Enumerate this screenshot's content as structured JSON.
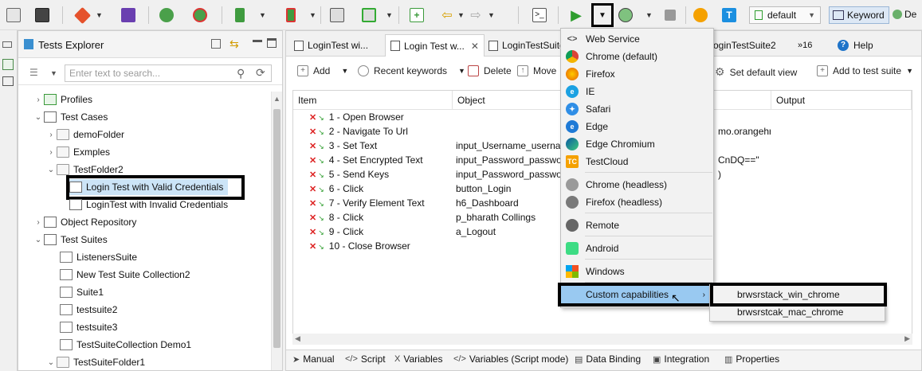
{
  "toolbar": {
    "profile_value": "default",
    "keyword_label": "Keyword",
    "de_label": "De"
  },
  "explorer": {
    "title": "Tests Explorer",
    "search_placeholder": "Enter text to search...",
    "tree": [
      {
        "label": "Profiles"
      },
      {
        "label": "Test Cases"
      },
      {
        "label": "demoFolder"
      },
      {
        "label": "Exmples"
      },
      {
        "label": "TestFolder2"
      },
      {
        "label": "Login Test with Valid Credentials"
      },
      {
        "label": "LoginTest with Invalid Credentials"
      },
      {
        "label": "Object Repository"
      },
      {
        "label": "Test Suites"
      },
      {
        "label": "ListenersSuite"
      },
      {
        "label": "New Test Suite Collection2"
      },
      {
        "label": "Suite1"
      },
      {
        "label": "testsuite2"
      },
      {
        "label": "testsuite3"
      },
      {
        "label": "TestSuiteCollection Demo1"
      },
      {
        "label": "TestSuiteFolder1"
      }
    ]
  },
  "editor": {
    "tabs": [
      "LoginTest wi...",
      "Login Test w...",
      "LoginTestSuite",
      "oginTestSuite2",
      "»16",
      "Help"
    ],
    "toolbar": {
      "add": "Add",
      "recent": "Recent keywords",
      "delete": "Delete",
      "move": "Move",
      "set_default_view": "Set default view",
      "add_to_suite": "Add to test suite"
    },
    "columns": [
      "Item",
      "Object",
      "Output"
    ],
    "rows": [
      {
        "item": "1 - Open Browser",
        "object": "",
        "extra": ""
      },
      {
        "item": "2 - Navigate To Url",
        "object": "",
        "extra": "mo.orangehr"
      },
      {
        "item": "3 - Set Text",
        "object": "input_Username_usernar",
        "extra": ""
      },
      {
        "item": "4 - Set Encrypted Text",
        "object": "input_Password_passwor",
        "extra": "CnDQ==\""
      },
      {
        "item": "5 - Send Keys",
        "object": "input_Password_passwor",
        "extra": ")"
      },
      {
        "item": "6 - Click",
        "object": "button_Login",
        "extra": ""
      },
      {
        "item": "7 - Verify Element Text",
        "object": "h6_Dashboard",
        "extra": ""
      },
      {
        "item": "8 - Click",
        "object": "p_bharath Collings",
        "extra": ""
      },
      {
        "item": "9 - Click",
        "object": "a_Logout",
        "extra": ""
      },
      {
        "item": "10 - Close Browser",
        "object": "",
        "extra": ""
      }
    ],
    "bottom_tabs": [
      "Manual",
      "Script",
      "Variables",
      "Variables (Script mode)",
      "Data Binding",
      "Integration",
      "Properties"
    ]
  },
  "menu": {
    "items": [
      "Web Service",
      "Chrome (default)",
      "Firefox",
      "IE",
      "Safari",
      "Edge",
      "Edge Chromium",
      "TestCloud",
      "Chrome (headless)",
      "Firefox (headless)",
      "Remote",
      "Android",
      "Windows",
      "Custom capabilities"
    ],
    "submenu": [
      "brwsrstack_win_chrome",
      "brwsrstcak_mac_chrome"
    ]
  },
  "colors": {
    "highlight": "#99c9f1",
    "accent_blue": "#1f74c9",
    "run_green": "#2e9d2e"
  }
}
